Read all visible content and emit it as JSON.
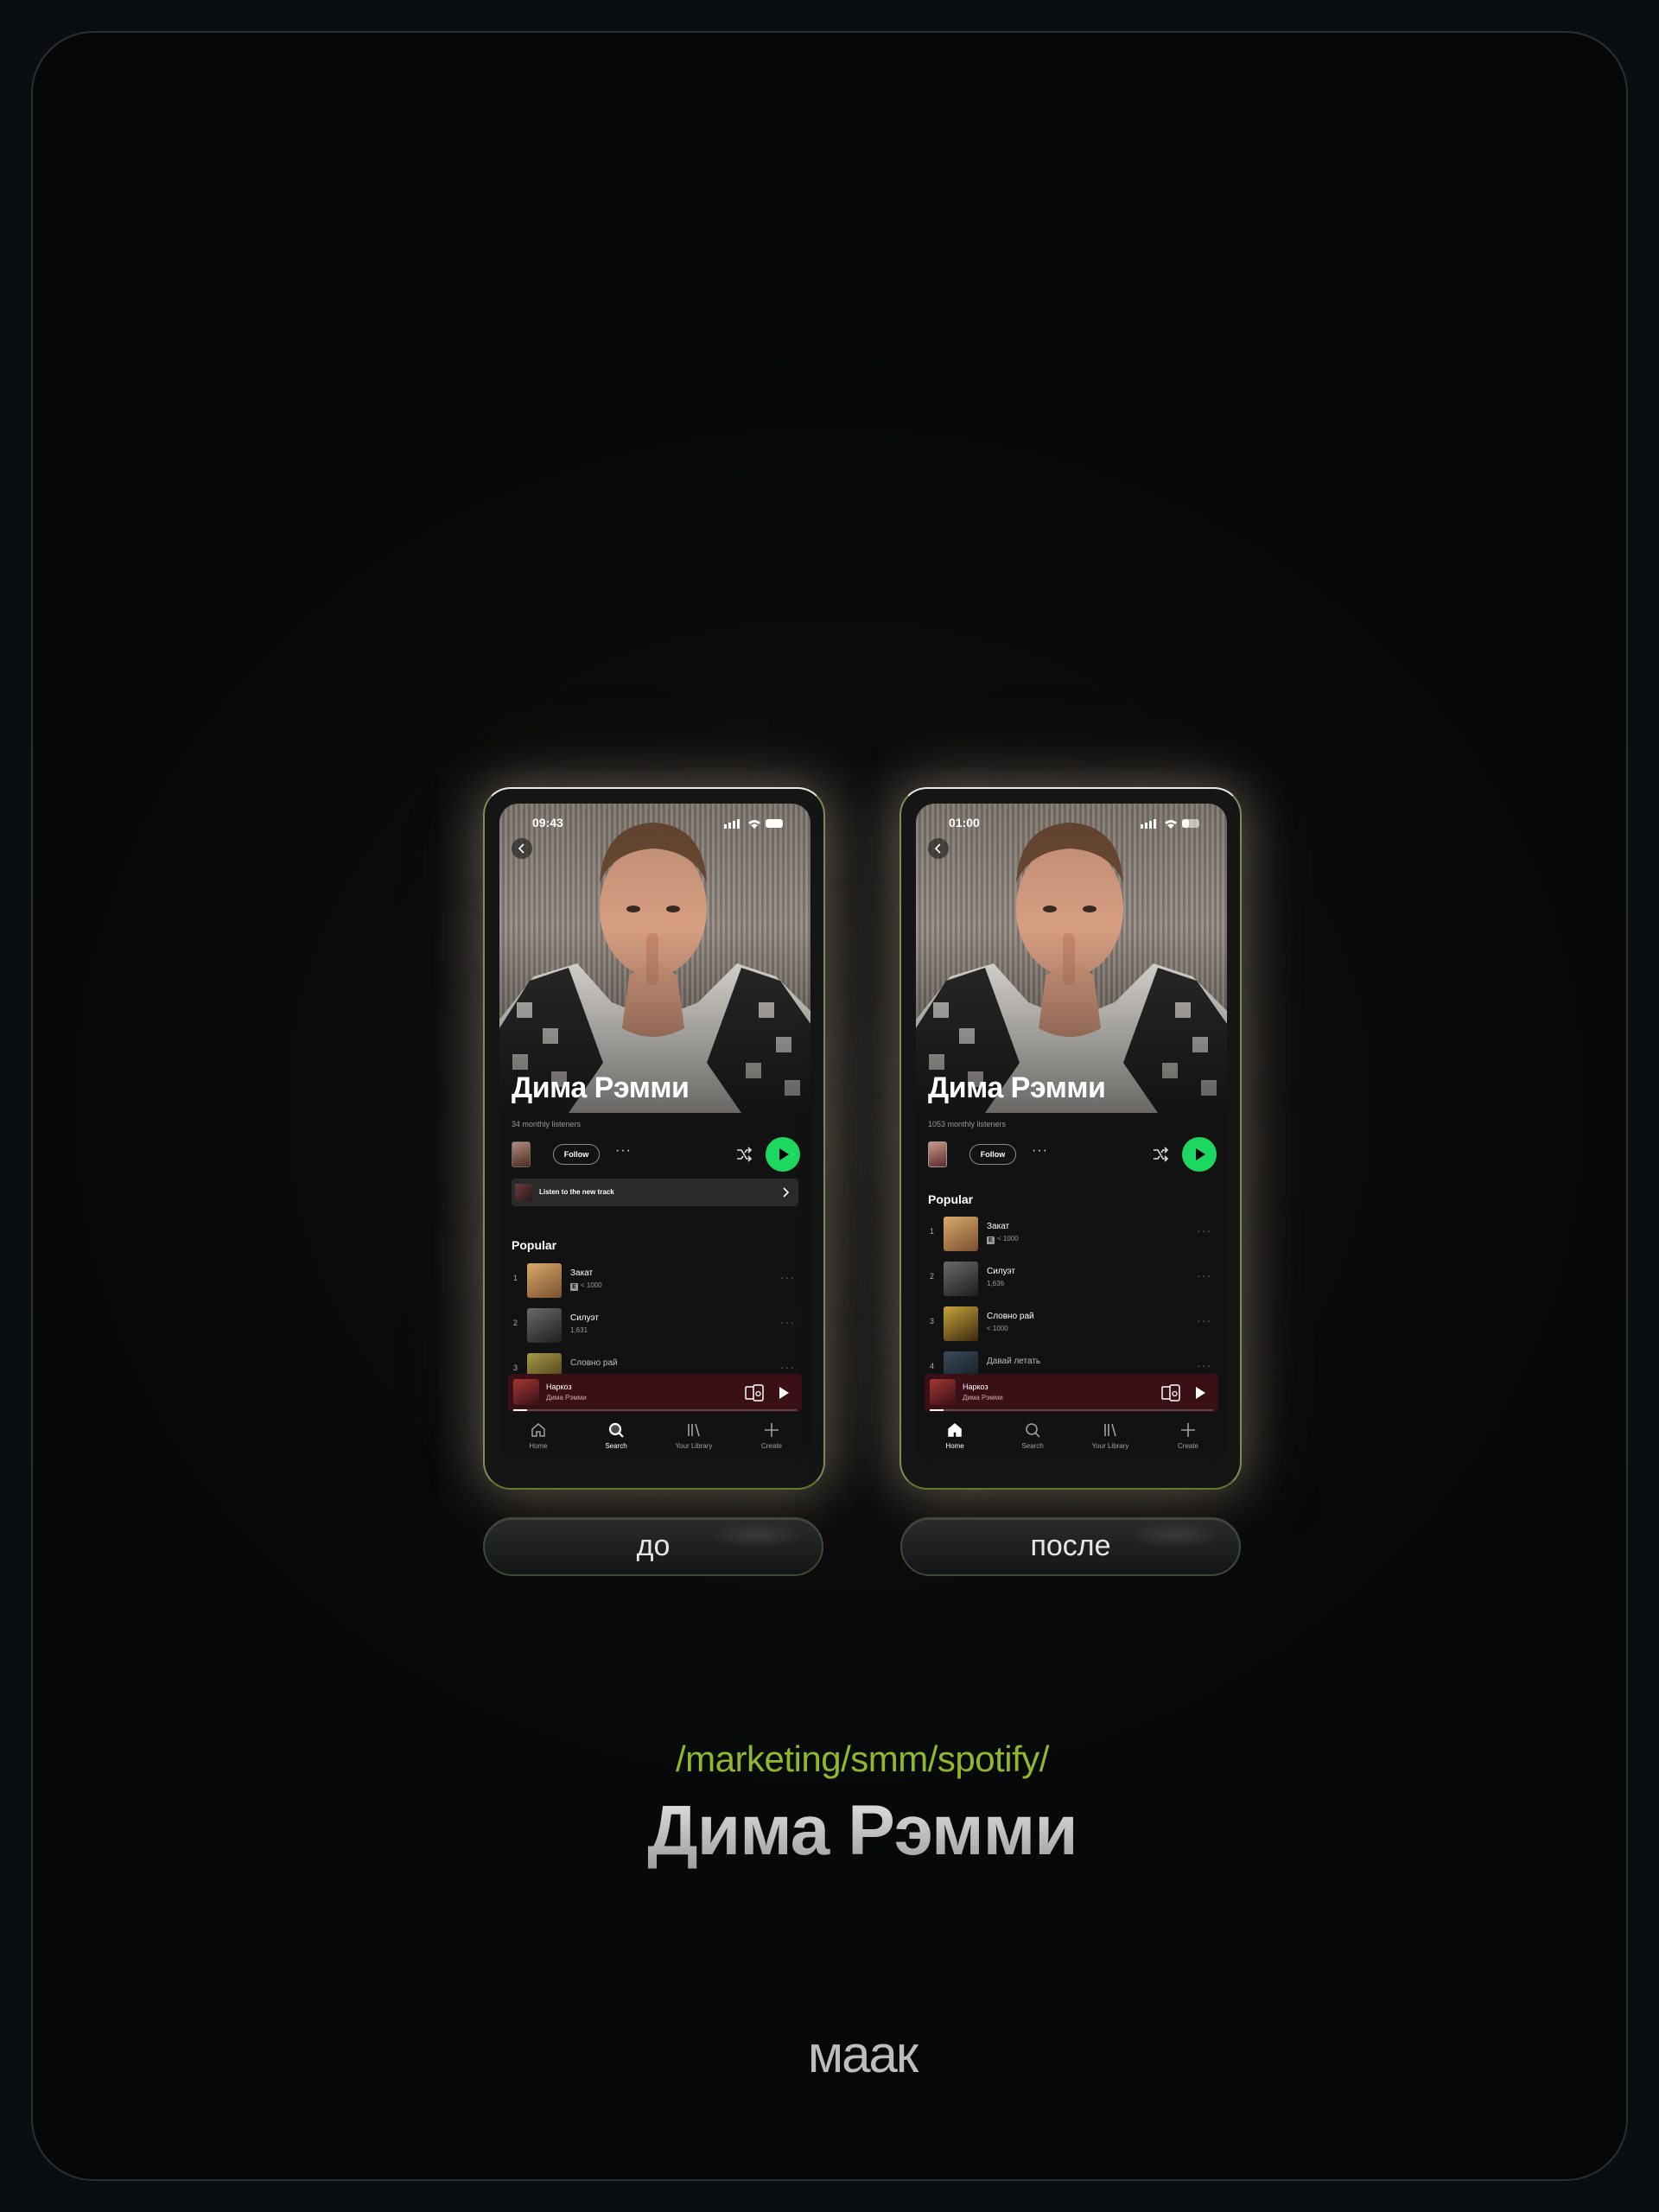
{
  "comparison": {
    "before_label": "до",
    "after_label": "после"
  },
  "footer": {
    "path": "/marketing/smm/spotify/",
    "title": "Дима Рэмми",
    "brand": "маак"
  },
  "phone_before": {
    "time": "09:43",
    "artist_name": "Дима Рэмми",
    "monthly_listeners": "34 monthly listeners",
    "follow_label": "Follow",
    "new_track_label": "Listen to the new track",
    "popular_heading": "Popular",
    "tracks": [
      {
        "num": "1",
        "title": "Закат",
        "sub": "< 1000",
        "explicit": "E"
      },
      {
        "num": "2",
        "title": "Силуэт",
        "sub": "1,631"
      },
      {
        "num": "3",
        "title": "Словно рай",
        "sub": ""
      }
    ],
    "now_playing": {
      "title": "Наркоз",
      "artist": "Дима Рэмми",
      "progress": 0.05
    },
    "tabs": [
      "Home",
      "Search",
      "Your Library",
      "Create"
    ],
    "active_tab": "Search"
  },
  "phone_after": {
    "time": "01:00",
    "artist_name": "Дима Рэмми",
    "monthly_listeners": "1053 monthly listeners",
    "follow_label": "Follow",
    "popular_heading": "Popular",
    "tracks": [
      {
        "num": "1",
        "title": "Закат",
        "sub": "< 1000",
        "explicit": "E"
      },
      {
        "num": "2",
        "title": "Силуэт",
        "sub": "1,636"
      },
      {
        "num": "3",
        "title": "Словно рай",
        "sub": "< 1000"
      },
      {
        "num": "4",
        "title": "Давай летать",
        "sub": ""
      }
    ],
    "now_playing": {
      "title": "Наркоз",
      "artist": "Дима Рэмми",
      "progress": 0.05
    },
    "tabs": [
      "Home",
      "Search",
      "Your Library",
      "Create"
    ],
    "active_tab": "Home"
  },
  "colors": {
    "spotify_green": "#1ed760",
    "path_green": "#8fb82c",
    "now_playing_bg": "#3b0f16"
  }
}
